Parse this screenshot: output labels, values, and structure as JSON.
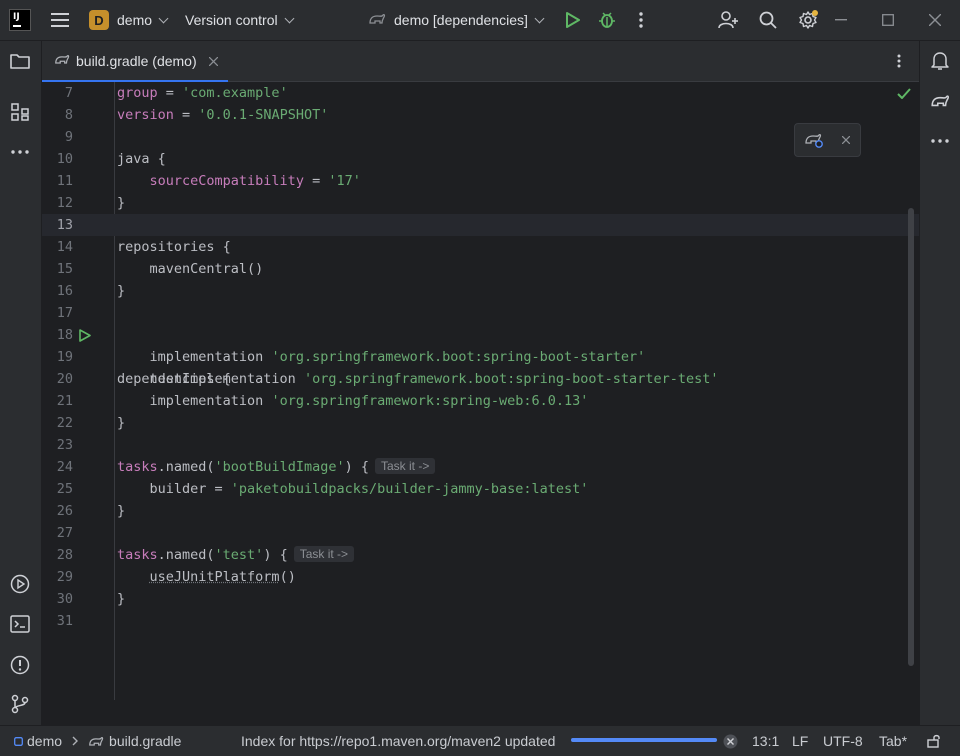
{
  "titlebar": {
    "project_badge": "D",
    "project_name": "demo",
    "vcs_label": "Version control",
    "run_config": "demo [dependencies]"
  },
  "tab": {
    "label": "build.gradle (demo)"
  },
  "editor": {
    "current_line": 13,
    "lines": [
      {
        "n": "7"
      },
      {
        "n": "8"
      },
      {
        "n": "9"
      },
      {
        "n": "10"
      },
      {
        "n": "11"
      },
      {
        "n": "12"
      },
      {
        "n": "13"
      },
      {
        "n": "14"
      },
      {
        "n": "15"
      },
      {
        "n": "16"
      },
      {
        "n": "17"
      },
      {
        "n": "18"
      },
      {
        "n": "19"
      },
      {
        "n": "20"
      },
      {
        "n": "21"
      },
      {
        "n": "22"
      },
      {
        "n": "23"
      },
      {
        "n": "24"
      },
      {
        "n": "25"
      },
      {
        "n": "26"
      },
      {
        "n": "27"
      },
      {
        "n": "28"
      },
      {
        "n": "29"
      },
      {
        "n": "30"
      },
      {
        "n": "31"
      }
    ],
    "code": {
      "l7_kw": "group",
      "l7_op": " = ",
      "l7_str": "'com.example'",
      "l8_kw": "version",
      "l8_op": " = ",
      "l8_str": "'0.0.1-SNAPSHOT'",
      "l10": "java {",
      "l11_kw": "sourceCompatibility",
      "l11_op": " = ",
      "l11_str": "'17'",
      "l12": "}",
      "l14": "repositories {",
      "l15": "mavenCentral()",
      "l16": "}",
      "l18": "dependencies {",
      "l19_a": "implementation ",
      "l19_str": "'org.springframework.boot:spring-boot-starter'",
      "l20_a": "testImplementation ",
      "l20_str": "'org.springframework.boot:spring-boot-starter-test'",
      "l21_a": "implementation ",
      "l21_str": "'org.springframework:spring-web:6.0.13'",
      "l22": "}",
      "l24_kw": "tasks",
      "l24_a": ".named(",
      "l24_str": "'bootBuildImage'",
      "l24_b": ") {",
      "l25_a": "builder = ",
      "l25_str": "'paketobuildpacks/builder-jammy-base:latest'",
      "l26": "}",
      "l28_kw": "tasks",
      "l28_a": ".named(",
      "l28_str": "'test'",
      "l28_b": ") {",
      "l29_fn": "useJUnitPlatform",
      "l29_b": "()",
      "l30": "}"
    },
    "inlay_hint": "Task it ->"
  },
  "statusbar": {
    "breadcrumb_project": "demo",
    "breadcrumb_file": "build.gradle",
    "message": "Index for https://repo1.maven.org/maven2 updated",
    "progress": 1.0,
    "position": "13:1",
    "line_sep": "LF",
    "encoding": "UTF-8",
    "indent": "Tab*"
  },
  "colors": {
    "accent": "#3574f0",
    "string": "#6aab73",
    "keyword": "#c77dbb"
  }
}
